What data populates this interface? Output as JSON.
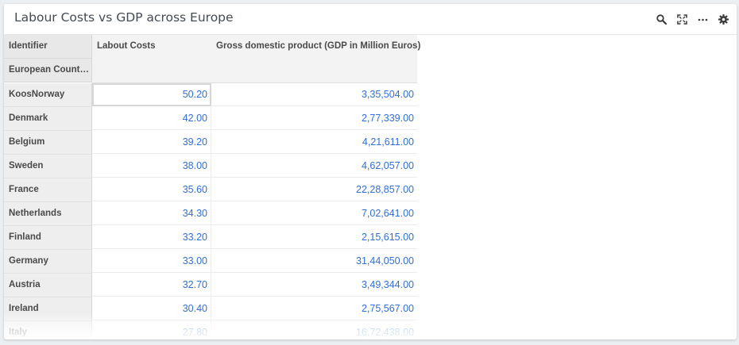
{
  "widget": {
    "title": "Labour Costs vs GDP across Europe",
    "toolbar": {
      "search": "search-icon",
      "expand": "expand-icon",
      "more": "more-icon",
      "settings": "gear-icon"
    }
  },
  "table": {
    "row_header_titles": [
      "Identifier",
      "European Countr…"
    ],
    "columns": [
      "Labout Costs",
      "Gross domestic product (GDP in Million Euros)"
    ],
    "rows": [
      {
        "label": "KoosNorway",
        "values": [
          "50.20",
          "3,35,504.00"
        ]
      },
      {
        "label": "Denmark",
        "values": [
          "42.00",
          "2,77,339.00"
        ]
      },
      {
        "label": "Belgium",
        "values": [
          "39.20",
          "4,21,611.00"
        ]
      },
      {
        "label": "Sweden",
        "values": [
          "38.00",
          "4,62,057.00"
        ]
      },
      {
        "label": "France",
        "values": [
          "35.60",
          "22,28,857.00"
        ]
      },
      {
        "label": "Netherlands",
        "values": [
          "34.30",
          "7,02,641.00"
        ]
      },
      {
        "label": "Finland",
        "values": [
          "33.20",
          "2,15,615.00"
        ]
      },
      {
        "label": "Germany",
        "values": [
          "33.00",
          "31,44,050.00"
        ]
      },
      {
        "label": "Austria",
        "values": [
          "32.70",
          "3,49,344.00"
        ]
      },
      {
        "label": "Ireland",
        "values": [
          "30.40",
          "2,75,567.00"
        ]
      },
      {
        "label": "Italy",
        "values": [
          "27.80",
          "16,72,438.00"
        ]
      }
    ]
  },
  "colors": {
    "value_text": "#2f6fd6",
    "header_bg": "#e8e8e8",
    "title_text": "#434a54"
  }
}
